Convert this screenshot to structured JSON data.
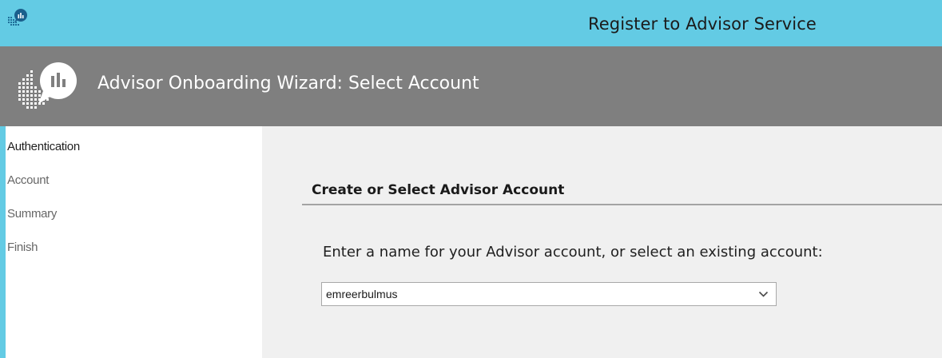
{
  "window": {
    "title": "Register to Advisor Service",
    "app_icon": "advisor-chat-icon"
  },
  "banner": {
    "title": "Advisor Onboarding Wizard: Select Account",
    "logo_icon": "advisor-logo-icon"
  },
  "nav": {
    "items": [
      {
        "label": "Authentication",
        "active": true
      },
      {
        "label": "Account",
        "active": false
      },
      {
        "label": "Summary",
        "active": false
      },
      {
        "label": "Finish",
        "active": false
      }
    ]
  },
  "content": {
    "section_title": "Create or Select Advisor Account",
    "prompt": "Enter a name for your Advisor account, or select an existing account:",
    "account_select": {
      "value": "emreerbulmus",
      "icon": "chevron-down-icon"
    }
  },
  "colors": {
    "title_bar": "#63cbe4",
    "banner": "#7f7f7f",
    "content_bg": "#f0f0f0"
  }
}
